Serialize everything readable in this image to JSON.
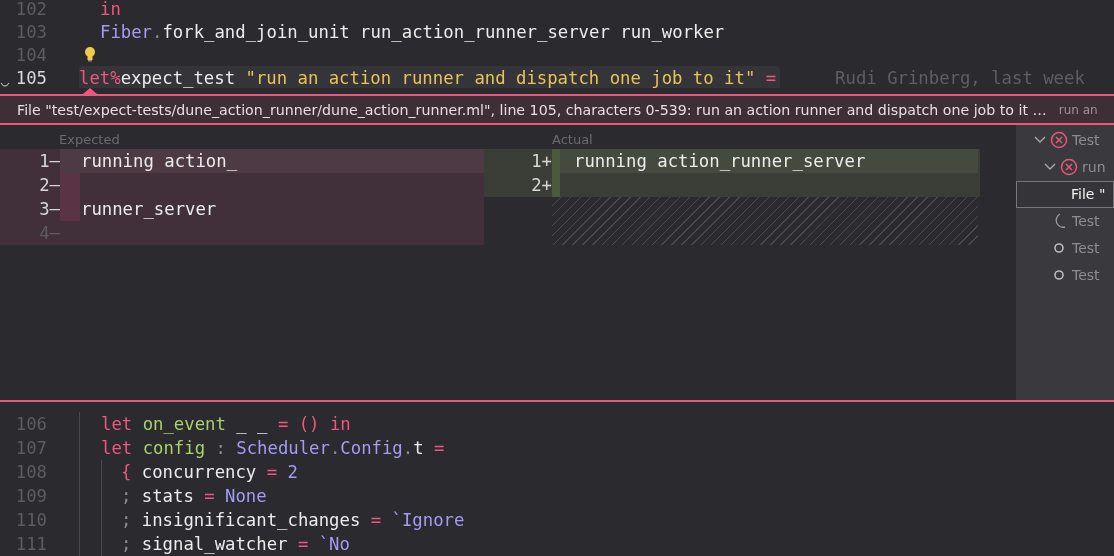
{
  "top_editor": {
    "lines": [
      {
        "number": "102",
        "current": false,
        "indent": true,
        "tokens": [
          {
            "text": "in",
            "kind": "keyword"
          }
        ]
      },
      {
        "number": "103",
        "current": false,
        "indent": true,
        "tokens": [
          {
            "text": "Fiber",
            "kind": "module"
          },
          {
            "text": ".",
            "kind": "punct"
          },
          {
            "text": "fork_and_join_unit run_action_runner_server run_worker",
            "kind": "plain"
          }
        ]
      },
      {
        "number": "104",
        "current": false,
        "bulb": true
      },
      {
        "number": "105",
        "current": true,
        "foldable": true,
        "tokens": [
          {
            "text": "let%",
            "kind": "keyword"
          },
          {
            "text": "expect_test ",
            "kind": "plain"
          },
          {
            "text": "\"run an action runner and dispatch one job to it\"",
            "kind": "string"
          },
          {
            "text": " =",
            "kind": "operator"
          }
        ],
        "blame": "Rudi Grinberg, last week"
      }
    ]
  },
  "banner": {
    "message": "File \"test/expect-tests/dune_action_runner/dune_action_runner.ml\", line 105, characters 0-539: run an action runner and dispatch one job to it …",
    "hint": "run an"
  },
  "diff": {
    "expected": {
      "label": "Expected",
      "rows": [
        {
          "number": "1—",
          "text": "running action_",
          "selected": true,
          "changed": false,
          "phantom": false
        },
        {
          "number": "2—",
          "selected": false,
          "changed": true,
          "phantom": false
        },
        {
          "number": "3—",
          "text": "runner_server",
          "selected": false,
          "changed": true,
          "phantom": false
        },
        {
          "number": "4—",
          "selected": false,
          "changed": false,
          "phantom": true
        }
      ]
    },
    "actual": {
      "label": "Actual",
      "rows": [
        {
          "number": "1+",
          "text": "running action_runner_server",
          "selected": true
        },
        {
          "number": "2+",
          "selected": false
        }
      ]
    }
  },
  "test_tree": [
    {
      "label": "Test",
      "kind": "failed",
      "expanded": true,
      "selected": false,
      "children": [
        {
          "label": "run",
          "kind": "failed",
          "expanded": true,
          "selected": false,
          "children": [
            {
              "label": "File \"",
              "selected": true
            }
          ]
        }
      ]
    },
    {
      "label": "Test",
      "kind": "running",
      "selected": false
    },
    {
      "label": "Test",
      "kind": "pending",
      "selected": false
    },
    {
      "label": "Test",
      "kind": "pending",
      "selected": false
    }
  ],
  "bottom_editor": {
    "lines": [
      {
        "number": "106",
        "guide": false,
        "tokens": [
          {
            "text": "let ",
            "kind": "keyword"
          },
          {
            "text": "on_event",
            "kind": "function"
          },
          {
            "text": " _ _ ",
            "kind": "plain"
          },
          {
            "text": "= () in",
            "kind": "keyword"
          }
        ]
      },
      {
        "number": "107",
        "guide": false,
        "tokens": [
          {
            "text": "let ",
            "kind": "keyword"
          },
          {
            "text": "config",
            "kind": "function"
          },
          {
            "text": " : ",
            "kind": "punct"
          },
          {
            "text": "Scheduler",
            "kind": "module"
          },
          {
            "text": ".",
            "kind": "punct"
          },
          {
            "text": "Config",
            "kind": "module"
          },
          {
            "text": ".",
            "kind": "punct"
          },
          {
            "text": "t ",
            "kind": "plain"
          },
          {
            "text": "=",
            "kind": "operator"
          }
        ]
      },
      {
        "number": "108",
        "guide": true,
        "tokens": [
          {
            "text": "{ ",
            "kind": "keyword"
          },
          {
            "text": "concurrency ",
            "kind": "plain"
          },
          {
            "text": "= ",
            "kind": "operator"
          },
          {
            "text": "2",
            "kind": "number"
          }
        ]
      },
      {
        "number": "109",
        "guide": true,
        "tokens": [
          {
            "text": "; ",
            "kind": "punct"
          },
          {
            "text": "stats ",
            "kind": "plain"
          },
          {
            "text": "= ",
            "kind": "operator"
          },
          {
            "text": "None",
            "kind": "module"
          }
        ]
      },
      {
        "number": "110",
        "guide": true,
        "tokens": [
          {
            "text": "; ",
            "kind": "punct"
          },
          {
            "text": "insignificant_changes ",
            "kind": "plain"
          },
          {
            "text": "= ",
            "kind": "operator"
          },
          {
            "text": "`Ignore",
            "kind": "module"
          }
        ]
      },
      {
        "number": "111",
        "guide": true,
        "tokens": [
          {
            "text": "; ",
            "kind": "punct"
          },
          {
            "text": "signal_watcher ",
            "kind": "plain"
          },
          {
            "text": "= ",
            "kind": "operator"
          },
          {
            "text": "`No",
            "kind": "module"
          }
        ]
      }
    ]
  }
}
